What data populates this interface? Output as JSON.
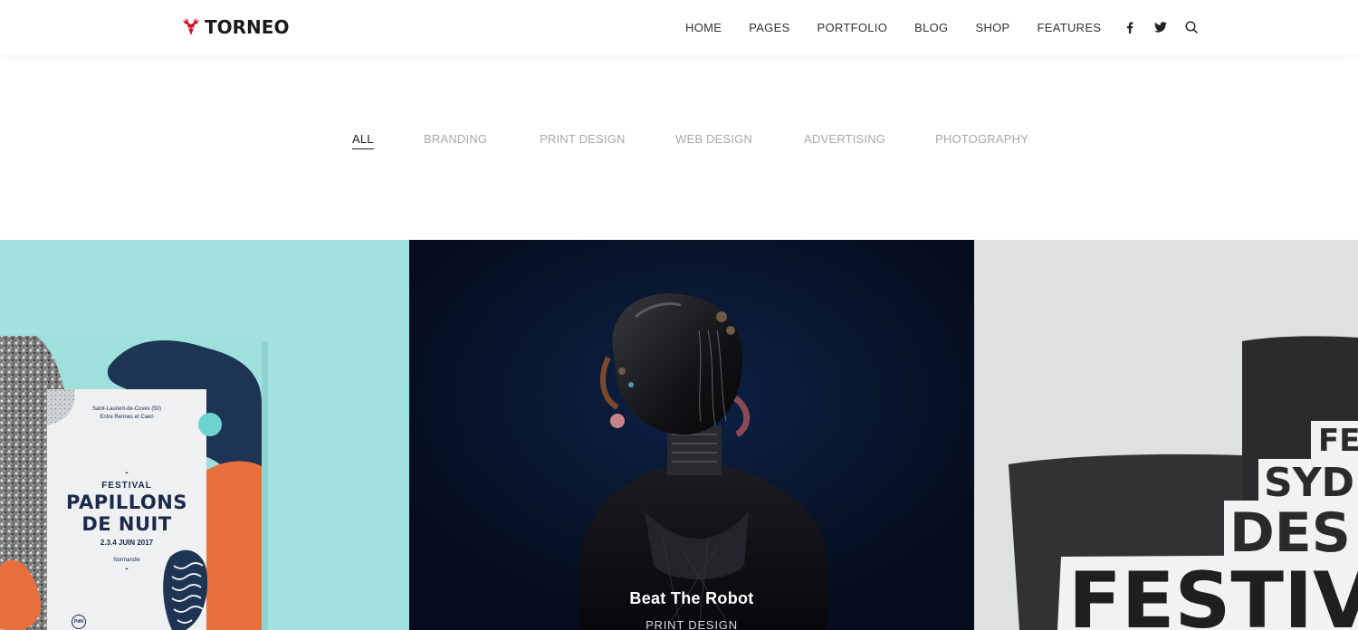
{
  "brand": {
    "name": "TORNEO",
    "accent_color": "#d0102a"
  },
  "nav": {
    "items": [
      {
        "label": "HOME"
      },
      {
        "label": "PAGES"
      },
      {
        "label": "PORTFOLIO"
      },
      {
        "label": "BLOG"
      },
      {
        "label": "SHOP"
      },
      {
        "label": "FEATURES"
      }
    ],
    "icons": [
      "facebook-icon",
      "twitter-icon",
      "search-icon"
    ]
  },
  "filters": {
    "items": [
      {
        "label": "ALL",
        "active": true
      },
      {
        "label": "BRANDING",
        "active": false
      },
      {
        "label": "PRINT DESIGN",
        "active": false
      },
      {
        "label": "WEB DESIGN",
        "active": false
      },
      {
        "label": "ADVERTISING",
        "active": false
      },
      {
        "label": "PHOTOGRAPHY",
        "active": false
      }
    ]
  },
  "portfolio": {
    "items": [
      {
        "background": "#a3e2e0",
        "poster": {
          "location_line1": "Saint-Laurent-de-Cuves (50)",
          "location_line2": "Entre Rennes et Caen",
          "separator": "-",
          "festival": "FESTIVAL",
          "title_line1": "PAPILLONS",
          "title_line2": "DE NUIT",
          "date": "2.3.4 JUIN 2017",
          "region": "Normandie",
          "badge": "PdN"
        }
      },
      {
        "background": "#071225",
        "title": "Beat The Robot",
        "category": "PRINT DESIGN"
      },
      {
        "background": "#dfe0e1",
        "book_words": [
          "FE",
          "SYD",
          "DES",
          "FESTIV"
        ]
      }
    ]
  }
}
